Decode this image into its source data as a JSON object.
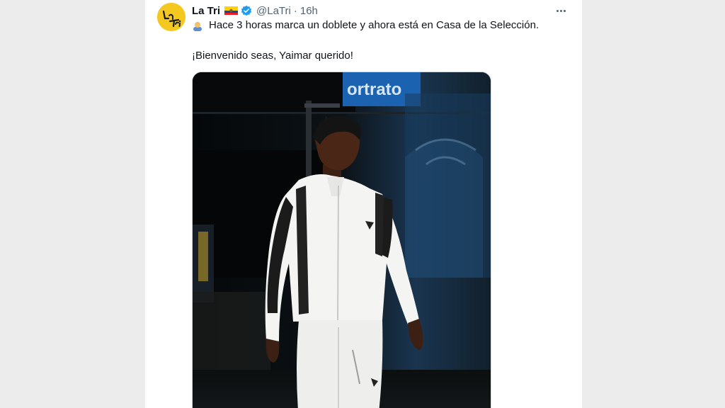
{
  "tweet": {
    "display_name": "La Tri",
    "flag_emoji": "🇪🇨",
    "handle": "@LaTri",
    "separator": "·",
    "time": "16h",
    "line1_emoji": "person-emoji",
    "line1": "Hace 3 horas marca un doblete y ahora está en Casa de la Selección.",
    "line2": "¡Bienvenido seas, Yaimar querido!",
    "avatar_text": "La Tri",
    "photo_sign_text": "ortrato",
    "colors": {
      "avatar_bg": "#f4c81e",
      "verified_blue": "#1d9bf0",
      "text": "#0f1419",
      "muted": "#536471"
    }
  }
}
